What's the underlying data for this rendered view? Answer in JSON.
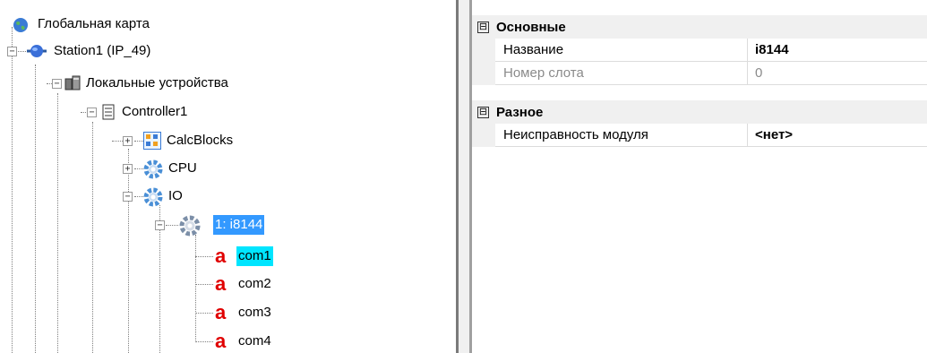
{
  "tree": {
    "nodes": [
      {
        "label": "Глобальная карта",
        "icon": "globe-icon"
      },
      {
        "label": "Station1 (IP_49)",
        "icon": "station-icon"
      },
      {
        "label": "Локальные устройства",
        "icon": "local-devices-icon"
      },
      {
        "label": "Controller1",
        "icon": "controller-icon"
      },
      {
        "label": "CalcBlocks",
        "icon": "calcblocks-icon"
      },
      {
        "label": "CPU",
        "icon": "gear-icon"
      },
      {
        "label": "IO",
        "icon": "gear-icon"
      },
      {
        "label": "1: i8144",
        "icon": "gear-icon",
        "selected": true
      },
      {
        "label": "com1",
        "icon": "port-icon",
        "highlighted": true
      },
      {
        "label": "com2",
        "icon": "port-icon"
      },
      {
        "label": "com3",
        "icon": "port-icon"
      },
      {
        "label": "com4",
        "icon": "port-icon"
      }
    ]
  },
  "property_grid": {
    "categories": [
      {
        "title": "Основные",
        "toggle": "⊟",
        "rows": [
          {
            "name": "Название",
            "value": "i8144",
            "bold_value": true
          },
          {
            "name": "Номер слота",
            "value": "0",
            "disabled": true
          }
        ]
      },
      {
        "title": "Разное",
        "toggle": "⊟",
        "rows": [
          {
            "name": "Неисправность модуля",
            "value": "<нет>",
            "bold_value": true
          }
        ]
      }
    ]
  },
  "colors": {
    "selection": "#3399ff",
    "highlight": "#00e5ff",
    "port_icon": "#e00000",
    "gear": "#4a8fd6"
  }
}
